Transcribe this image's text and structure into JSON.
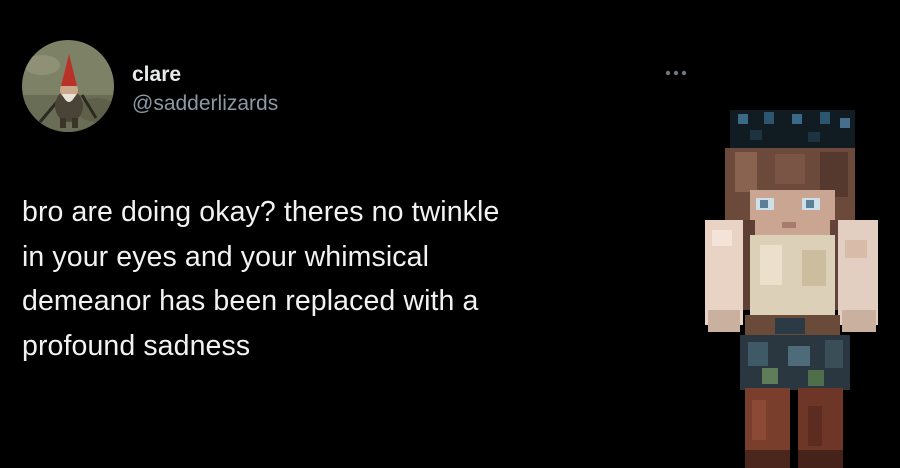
{
  "tweet": {
    "author": {
      "display_name": "clare",
      "handle": "@sadderlizards",
      "avatar_icon": "gnome-avatar-icon"
    },
    "more_icon": "more-options-icon",
    "text_lines": [
      "bro are doing okay? theres no twinkle",
      "in your eyes and your whimsical",
      "demeanor has been replaced with a",
      "profound sadness"
    ]
  },
  "overlay": {
    "image_icon": "minecraft-character-image"
  },
  "colors": {
    "background": "#000000",
    "primary_text": "#e7e9ea",
    "secondary_text": "#8b98a5"
  }
}
